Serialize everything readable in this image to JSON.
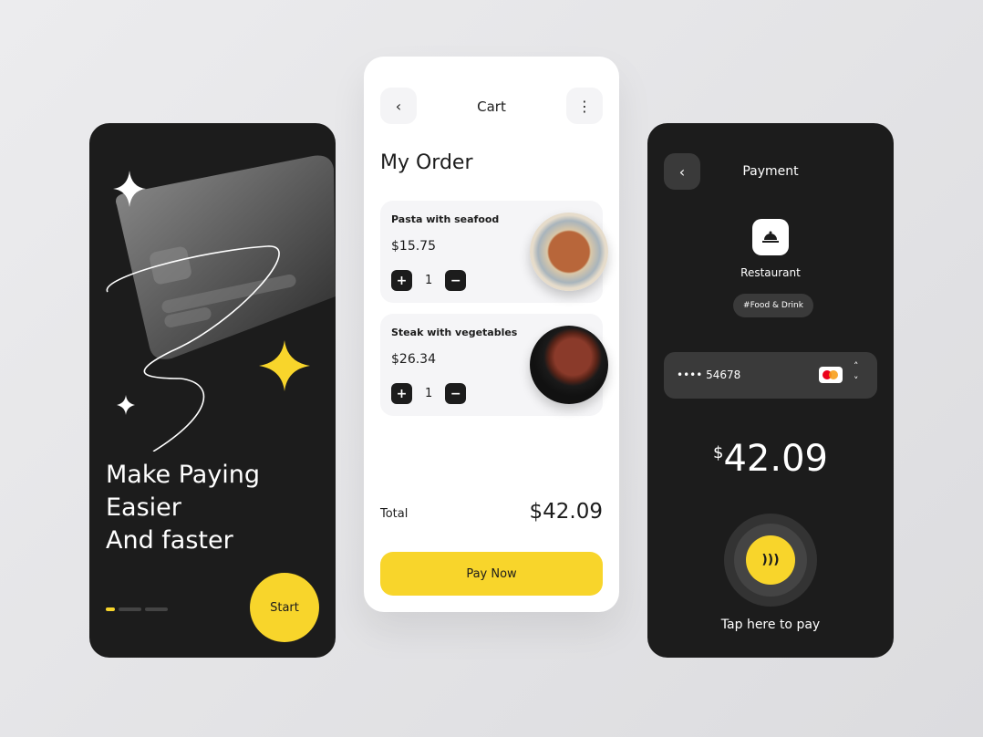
{
  "colors": {
    "accent": "#f8d52b",
    "dark": "#1c1c1c",
    "surface": "#3a3a3a"
  },
  "onboarding": {
    "headline": [
      "Make Paying",
      "Easier",
      "And faster"
    ],
    "start_label": "Start",
    "page_count": 3,
    "active_page": 1
  },
  "cart": {
    "title": "Cart",
    "heading": "My Order",
    "items": [
      {
        "name": "Pasta with seafood",
        "price": "$15.75",
        "qty": "1"
      },
      {
        "name": "Steak with vegetables",
        "price": "$26.34",
        "qty": "1"
      }
    ],
    "total_label": "Total",
    "total_value": "$42.09",
    "pay_label": "Pay Now"
  },
  "payment": {
    "title": "Payment",
    "merchant": "Restaurant",
    "tag": "#Food & Drink",
    "card_masked": "•••• 54678",
    "currency": "$",
    "amount": "42.09",
    "tap_label": "Tap  here to pay"
  }
}
